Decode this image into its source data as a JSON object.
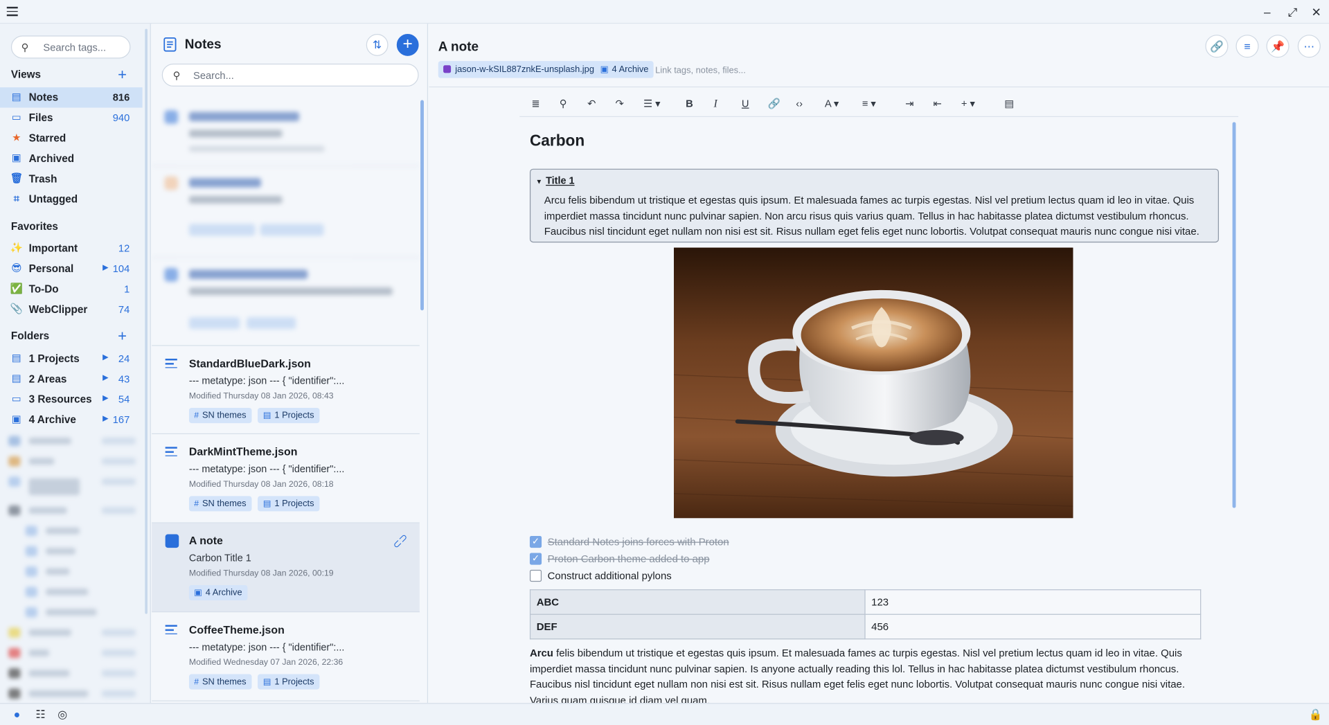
{
  "window": {
    "controls": [
      "–",
      "⤢",
      "✕"
    ]
  },
  "sidebar": {
    "search_placeholder": "Search tags...",
    "views_title": "Views",
    "views": [
      {
        "label": "Notes",
        "count": "816",
        "icon": "notes-icon"
      },
      {
        "label": "Files",
        "count": "940",
        "icon": "folder-icon"
      },
      {
        "label": "Starred",
        "count": "",
        "icon": "star-icon"
      },
      {
        "label": "Archived",
        "count": "",
        "icon": "archive-icon"
      },
      {
        "label": "Trash",
        "count": "",
        "icon": "trash-icon"
      },
      {
        "label": "Untagged",
        "count": "",
        "icon": "untagged-icon"
      }
    ],
    "favorites_title": "Favorites",
    "favorites": [
      {
        "label": "Important",
        "count": "12",
        "emoji": "✨"
      },
      {
        "label": "Personal",
        "count": "104",
        "emoji": "😎"
      },
      {
        "label": "To-Do",
        "count": "1",
        "emoji": "✅"
      },
      {
        "label": "WebClipper",
        "count": "74",
        "emoji": "📎"
      }
    ],
    "folders_title": "Folders",
    "folders": [
      {
        "label": "1 Projects",
        "count": "24"
      },
      {
        "label": "2 Areas",
        "count": "43"
      },
      {
        "label": "3 Resources",
        "count": "54"
      },
      {
        "label": "4 Archive",
        "count": "167"
      }
    ]
  },
  "notes_list": {
    "title": "Notes",
    "search_placeholder": "Search...",
    "items": [
      {
        "title": "StandardBlueDark.json",
        "preview": "--- metatype: json --- { \"identifier\":...",
        "modified": "Modified Thursday 08 Jan 2026, 08:43",
        "tags": [
          "SN themes",
          "1 Projects"
        ]
      },
      {
        "title": "DarkMintTheme.json",
        "preview": "--- metatype: json --- { \"identifier\":...",
        "modified": "Modified Thursday 08 Jan 2026, 08:18",
        "tags": [
          "SN themes",
          "1 Projects"
        ]
      },
      {
        "title": "A note",
        "preview": "Carbon Title 1",
        "modified": "Modified Thursday 08 Jan 2026, 00:19",
        "tags": [
          "4 Archive"
        ]
      },
      {
        "title": "CoffeeTheme.json",
        "preview": "--- metatype: json --- { \"identifier\":...",
        "modified": "Modified Wednesday 07 Jan 2026, 22:36",
        "tags": [
          "SN themes",
          "1 Projects"
        ]
      }
    ]
  },
  "editor": {
    "title": "A note",
    "attachment": "jason-w-kSIL887znkE-unsplash.jpg",
    "folder_chip": "4 Archive",
    "link_placeholder": "Link tags, notes, files...",
    "heading": "Carbon",
    "details_summary": "Title 1",
    "details_body": "Arcu felis bibendum ut tristique et egestas quis ipsum. Et malesuada fames ac turpis egestas. Nisl vel pretium lectus quam id leo in vitae. Quis imperdiet massa tincidunt nunc pulvinar sapien. Non arcu risus quis varius quam. Tellus in hac habitasse platea dictumst vestibulum rhoncus. Faucibus nisl tincidunt eget nullam non nisi est sit. Risus nullam eget felis eget nunc lobortis. Volutpat consequat mauris nunc congue nisi vitae.",
    "checklist": [
      {
        "text": "Standard Notes joins forces with Proton",
        "done": true
      },
      {
        "text": "Proton Carbon theme added to app",
        "done": true
      },
      {
        "text": "Construct additional pylons",
        "done": false
      }
    ],
    "table": [
      {
        "key": "ABC",
        "value": "123"
      },
      {
        "key": "DEF",
        "value": "456"
      }
    ],
    "para_bold": "Arcu",
    "para_rest": " felis bibendum ut tristique et egestas quis ipsum. Et malesuada fames ac turpis egestas. Nisl vel pretium lectus quam id leo in vitae. Quis imperdiet massa tincidunt nunc pulvinar sapien. Is anyone actually reading this lol. Tellus in hac habitasse platea dictumst vestibulum rhoncus. Faucibus nisl tincidunt eget nullam non nisi est sit. Risus nullam eget felis eget nunc lobortis. Volutpat consequat mauris nunc congue nisi vitae. Varius quam quisque id diam vel quam."
  },
  "colors": {
    "accent": "#2a6fdb",
    "selection": "#cfe1f7"
  }
}
